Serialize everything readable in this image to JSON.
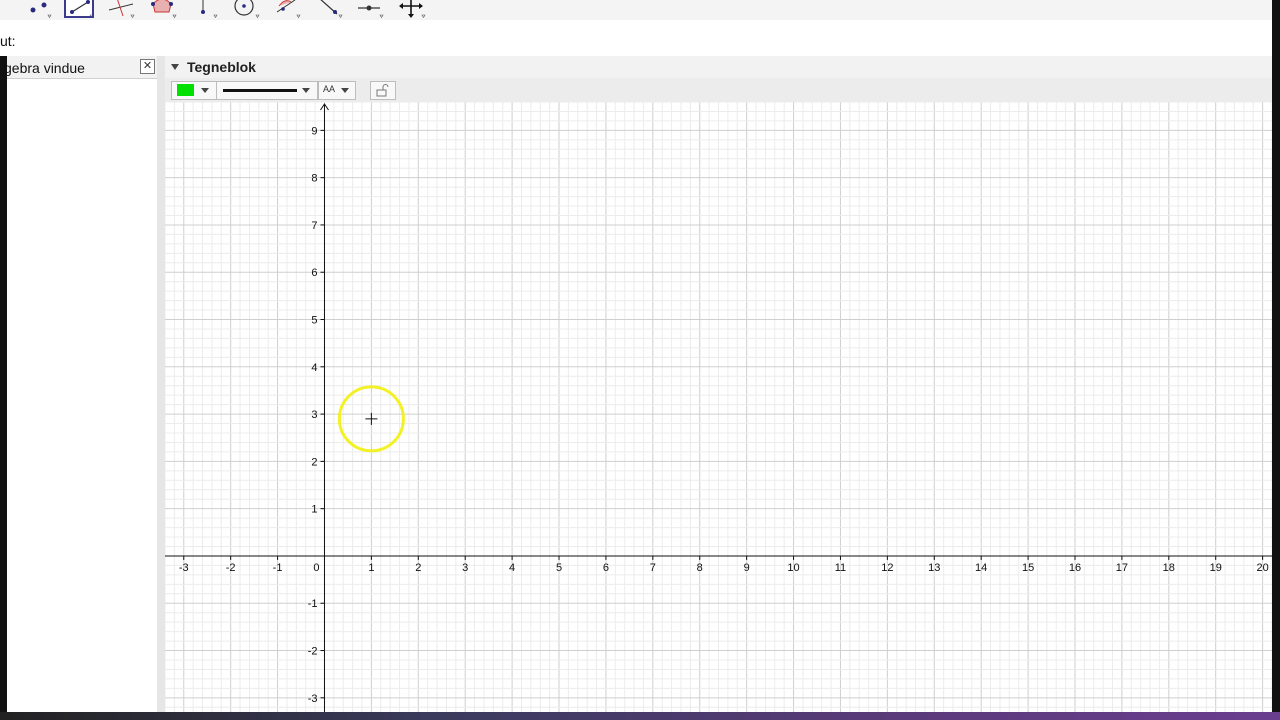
{
  "toolbar": {
    "tools": [
      {
        "name": "point-tool-icon",
        "active": false
      },
      {
        "name": "segment-tool-icon",
        "active": true
      },
      {
        "name": "perpendicular-line-tool-icon",
        "active": false
      },
      {
        "name": "polygon-tool-icon",
        "active": false
      },
      {
        "name": "circle-center-point-tool-icon",
        "active": false
      },
      {
        "name": "circle-tool-icon",
        "active": false
      },
      {
        "name": "angle-tool-icon",
        "active": false
      },
      {
        "name": "reflect-tool-icon",
        "active": false
      },
      {
        "name": "slider-tool-icon",
        "active": false
      },
      {
        "name": "move-graphics-view-tool-icon",
        "active": false
      }
    ]
  },
  "input_bar": {
    "label": "ut:"
  },
  "algebra_view": {
    "title": "gebra vindue",
    "close_label": "✕"
  },
  "graphics_view": {
    "title": "Tegneblok",
    "style_bar": {
      "color_swatch": "#00e000",
      "line_style": "solid",
      "label_style_text": "AA"
    },
    "x_ticks": [
      "-3",
      "-2",
      "-1",
      "0",
      "1",
      "2",
      "3",
      "4",
      "5",
      "6",
      "7",
      "8",
      "9",
      "10",
      "11",
      "12",
      "13",
      "14",
      "15",
      "16",
      "17",
      "18",
      "19",
      "20"
    ],
    "y_ticks": [
      "9",
      "8",
      "7",
      "6",
      "5",
      "4",
      "3",
      "2",
      "1",
      "-1",
      "-2",
      "-3"
    ],
    "x_range": [
      -3.4,
      20.2
    ],
    "y_range": [
      -3.3,
      9.6
    ],
    "grid": true,
    "cursor": {
      "x": 1,
      "y": 2.9
    }
  },
  "colors": {
    "grid_major": "#cfcfcf",
    "grid_minor": "#ececec",
    "axis": "#111111",
    "highlight": "#f0f000",
    "accent": "#3a3a8c"
  }
}
